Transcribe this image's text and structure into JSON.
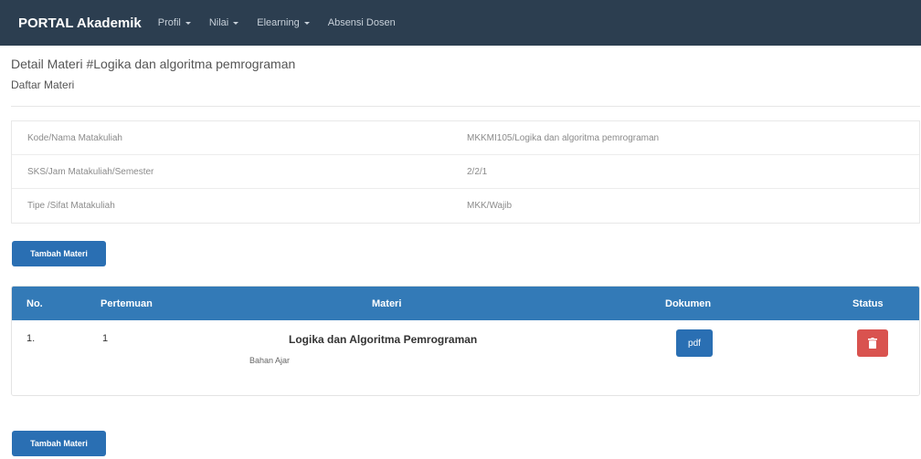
{
  "navbar": {
    "brand_part1": "PORTAL",
    "brand_part2": "Akademik",
    "items": [
      {
        "label": "Profil"
      },
      {
        "label": "Nilai"
      },
      {
        "label": "Elearning"
      },
      {
        "label": "Absensi Dosen"
      }
    ]
  },
  "page": {
    "title": "Detail Materi #Logika dan algoritma pemrograman",
    "subtitle": "Daftar Materi"
  },
  "info": {
    "rows": [
      {
        "key": "Kode/Nama Matakuliah",
        "value": "MKKMI105/Logika dan algoritma pemrograman"
      },
      {
        "key": "SKS/Jam Matakuliah/Semester",
        "value": "2/2/1"
      },
      {
        "key": "Tipe /Sifat Matakuliah",
        "value": "MKK/Wajib"
      }
    ]
  },
  "actions": {
    "add_label_top": "Tambah Materi",
    "add_label_bottom": "Tambah Materi"
  },
  "table": {
    "headers": {
      "no": "No.",
      "pertemuan": "Pertemuan",
      "materi": "Materi",
      "dokumen": "Dokumen",
      "status": "Status"
    },
    "rows": [
      {
        "no": "1.",
        "pertemuan": "1",
        "materi_title": "Logika dan Algoritma Pemrograman",
        "materi_sub": "Bahan Ajar",
        "dokumen": "pdf",
        "status_icon": "trash-icon"
      }
    ]
  },
  "colors": {
    "navbar": "#2c3e50",
    "primary": "#337ab7",
    "button": "#2a6fb3",
    "danger": "#d9534f"
  }
}
